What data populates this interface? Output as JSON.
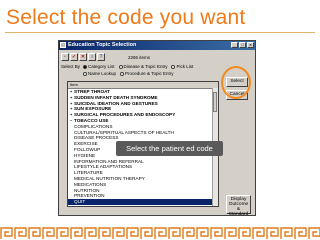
{
  "slide": {
    "title": "Select the code you want"
  },
  "window": {
    "title": "Education Topic Selection",
    "item_count": "2286 items",
    "select_by_label": "Select By",
    "options_row1": [
      "Category List",
      "Disease & Topic Entry",
      "Pick List"
    ],
    "options_row2": [
      "Name Lookup",
      "Procedure & Topic Entry"
    ],
    "list_header": "Item",
    "list_items": [
      "STREP THROAT",
      "SUDDEN INFANT DEATH SYNDROME",
      "SUICIDAL IDEATION AND GESTURES",
      "SUN EXPOSURE",
      "SURGICAL PROCEDURES AND ENDOSCOPY",
      "TOBACCO USE",
      "COMPLICATIONS",
      "CULTURAL/SPIRITUAL ASPECTS OF HEALTH",
      "DISEASE PROCESS",
      "EXERCISE",
      "FOLLOWUP",
      "HYGIENE",
      "INFORMATION AND REFERRAL",
      "LIFESTYLE ADAPTATIONS",
      "LITERATURE",
      "MEDICAL NUTRITION THERAPY",
      "MEDICATIONS",
      "NUTRITION",
      "PREVENTION",
      "QUIT"
    ],
    "buttons": {
      "select": "Select",
      "cancel": "Cancel",
      "display_l1": "Display",
      "display_l2": "Outcome &",
      "display_l3": "Standard"
    }
  },
  "callout": {
    "text": "Select the patient ed code"
  },
  "colors": {
    "title": "#ef7a1a",
    "highlight_ring": "#f28a1e",
    "border_pattern": "#e07a1c"
  }
}
